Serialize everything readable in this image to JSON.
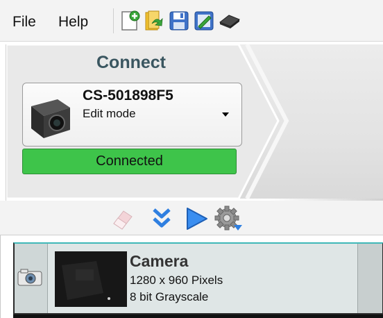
{
  "menu": {
    "file": "File",
    "help": "Help"
  },
  "toolbar": {
    "icons": [
      "new-job-icon",
      "open-job-icon",
      "save-icon",
      "edit-icon",
      "device-icon"
    ]
  },
  "connect": {
    "title": "Connect",
    "device_name": "CS-501898F5",
    "mode": "Edit mode",
    "status": "Connected",
    "status_color": "#3ec44a"
  },
  "actions": {
    "icons": [
      "eraser-icon",
      "double-chevron-down-icon",
      "play-icon",
      "settings-gear-icon"
    ]
  },
  "camera": {
    "title": "Camera",
    "resolution": "1280 x 960 Pixels",
    "depth": "8 bit Grayscale"
  },
  "colors": {
    "accent_blue": "#2f7fe0",
    "status_green": "#3ec44a",
    "title_teal": "#3a5660"
  }
}
